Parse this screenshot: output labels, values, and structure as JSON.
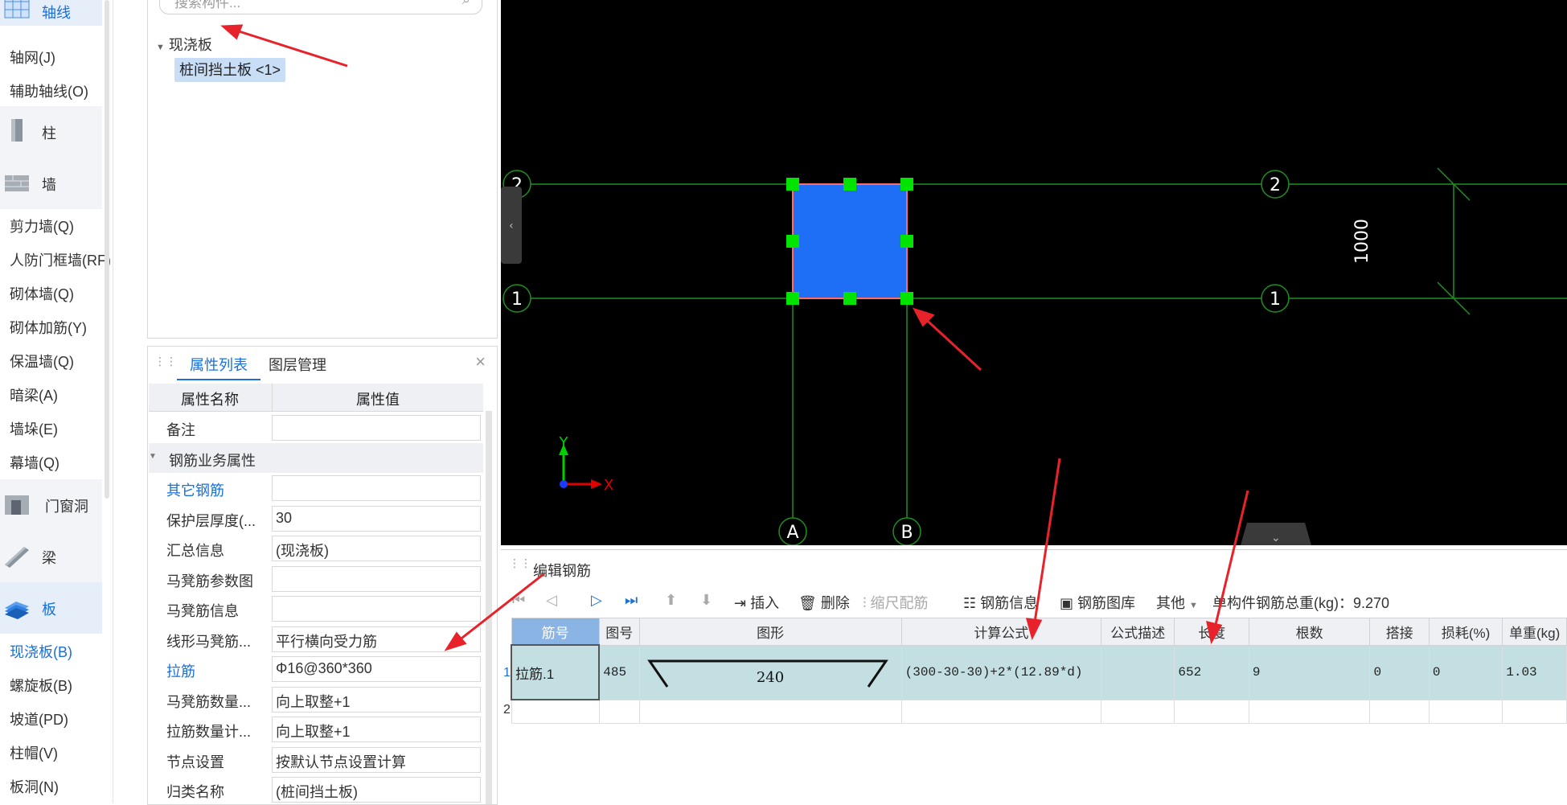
{
  "nav": {
    "categories": [
      {
        "label": "轴线",
        "icon": "grid-icon"
      },
      {
        "label": "柱",
        "icon": "column-icon"
      },
      {
        "label": "墙",
        "icon": "wall-icon"
      },
      {
        "label": "门窗洞",
        "icon": "door-window-icon"
      },
      {
        "label": "梁",
        "icon": "beam-icon"
      },
      {
        "label": "板",
        "icon": "slab-icon"
      }
    ],
    "items": {
      "axis": [
        "轴网(J)",
        "辅助轴线(O)"
      ],
      "wall": [
        "剪力墙(Q)",
        "人防门框墙(RF)",
        "砌体墙(Q)",
        "砌体加筋(Y)",
        "保温墙(Q)",
        "暗梁(A)",
        "墙垛(E)",
        "幕墙(Q)"
      ],
      "slab": [
        "现浇板(B)",
        "螺旋板(B)",
        "坡道(PD)",
        "柱帽(V)",
        "板洞(N)"
      ]
    }
  },
  "tree": {
    "search_placeholder": "搜索构件...",
    "group": "现浇板",
    "item": "桩间挡土板 <1>"
  },
  "props": {
    "tabs": [
      "属性列表",
      "图层管理"
    ],
    "headers": [
      "属性名称",
      "属性值"
    ],
    "rows": [
      {
        "name": "备注",
        "value": ""
      },
      {
        "name": "钢筋业务属性",
        "value": "",
        "group": true
      },
      {
        "name": "其它钢筋",
        "value": "",
        "link": true
      },
      {
        "name": "保护层厚度(...",
        "value": "30"
      },
      {
        "name": "汇总信息",
        "value": "(现浇板)"
      },
      {
        "name": "马凳筋参数图",
        "value": ""
      },
      {
        "name": "马凳筋信息",
        "value": ""
      },
      {
        "name": "线形马凳筋...",
        "value": "平行横向受力筋"
      },
      {
        "name": "拉筋",
        "value": "Φ16@360*360",
        "link": true
      },
      {
        "name": "马凳筋数量...",
        "value": "向上取整+1"
      },
      {
        "name": "拉筋数量计...",
        "value": "向上取整+1"
      },
      {
        "name": "节点设置",
        "value": "按默认节点设置计算"
      },
      {
        "name": "归类名称",
        "value": "(桩间挡土板)"
      }
    ]
  },
  "cad": {
    "axis_rows": [
      "2",
      "1"
    ],
    "axis_cols": [
      "A",
      "B"
    ],
    "dimension": "1000",
    "x_label": "X",
    "y_label": "Y",
    "colors": {
      "background": "#000000",
      "grid": "#1f8f1f",
      "slab": "#1e6ff5",
      "grip": "#00e400"
    }
  },
  "editor": {
    "title": "编辑钢筋",
    "toolbar": {
      "insert": "插入",
      "delete": "删除",
      "scale": "缩尺配筋",
      "rebar_info": "钢筋信息",
      "rebar_lib": "钢筋图库",
      "other": "其他",
      "total": "单构件钢筋总重(kg)：9.270"
    },
    "columns": [
      "筋号",
      "图号",
      "图形",
      "计算公式",
      "公式描述",
      "长度",
      "根数",
      "搭接",
      "损耗(%)",
      "单重(kg)"
    ],
    "rows": [
      {
        "num": "1",
        "name": "拉筋.1",
        "fig": "485",
        "shape_value": "240",
        "formula": "(300-30-30)+2*(12.89*d)",
        "desc": "",
        "length": "652",
        "count": "9",
        "lap": "0",
        "loss": "0",
        "unit": "1.03"
      },
      {
        "num": "2",
        "name": "",
        "fig": "",
        "shape_value": "",
        "formula": "",
        "desc": "",
        "length": "",
        "count": "",
        "lap": "",
        "loss": "",
        "unit": ""
      }
    ]
  }
}
